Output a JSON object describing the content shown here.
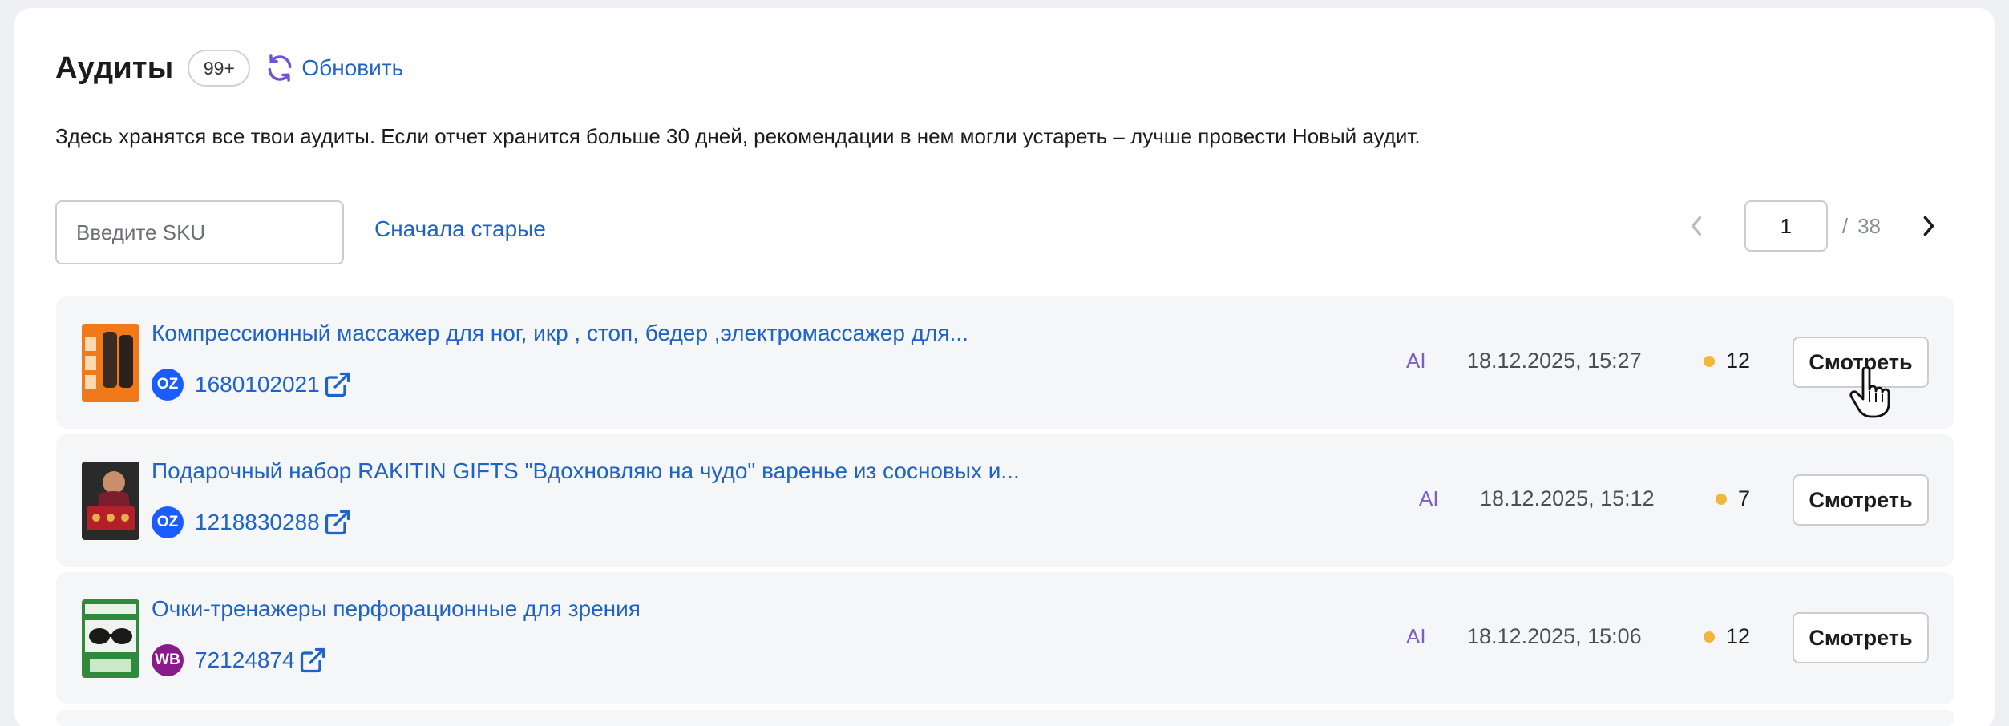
{
  "header": {
    "title": "Аудиты",
    "count_badge": "99+",
    "refresh_label": "Обновить"
  },
  "description": "Здесь хранятся все твои аудиты. Если отчет хранится больше 30 дней, рекомендации в нем могли устареть – лучше провести Новый аудит.",
  "filters": {
    "sku_placeholder": "Введите SKU",
    "sort_label": "Сначала старые"
  },
  "pagination": {
    "current_page": "1",
    "separator": "/",
    "total_pages": "38"
  },
  "colors": {
    "accent": "#1e63c5",
    "ai": "#7b5ec9",
    "score_dot": "#f4b63a",
    "ozon_badge": "#1a5cff",
    "wb_badge": "#8a1a8c"
  },
  "audits": [
    {
      "title": "Компрессионный массажер для ног, икр , стоп, бедер ,электромассажер для...",
      "marketplace": "OZ",
      "sku": "1680102021",
      "ai_label": "AI",
      "date": "18.12.2025, 15:27",
      "score": "12",
      "view_label": "Смотреть"
    },
    {
      "title": "Подарочный набор RAKITIN GIFTS \"Вдохновляю на чудо\" варенье из сосновых и...",
      "marketplace": "OZ",
      "sku": "1218830288",
      "ai_label": "AI",
      "date": "18.12.2025, 15:12",
      "score": "7",
      "view_label": "Смотреть"
    },
    {
      "title": "Очки-тренажеры перфорационные для зрения",
      "marketplace": "WB",
      "sku": "72124874",
      "ai_label": "AI",
      "date": "18.12.2025, 15:06",
      "score": "12",
      "view_label": "Смотреть"
    }
  ]
}
